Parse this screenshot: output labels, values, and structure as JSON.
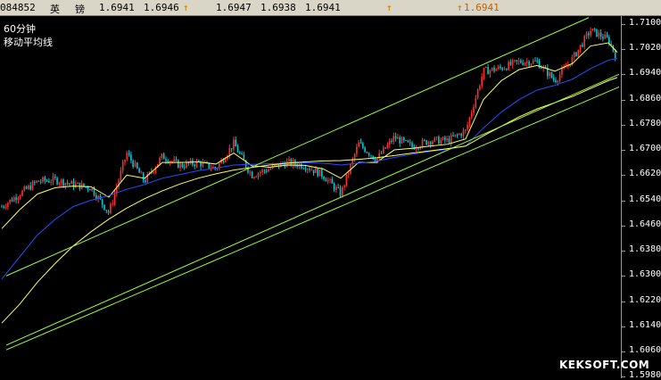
{
  "quote_bar": {
    "code": "084852",
    "name1": "英",
    "name2": "镑",
    "v1": "1.6941",
    "v2": "1.6946",
    "v3": "1.6947",
    "v4": "1.6938",
    "v5": "1.6941",
    "v6": "1.6941",
    "arrow_icon": "up-arrow-icon"
  },
  "titles": {
    "period": "60分钟",
    "indicator": "移动平均线"
  },
  "watermark": "KEKSOFT.COM",
  "colors": {
    "background": "#000000",
    "up_candle": "#ff3030",
    "down_candle": "#00c8d8",
    "ma_short": "#ffffff",
    "ma_mid": "#ffff60",
    "ma_long": "#2050ff",
    "trendline": "#9cff3c",
    "quote_bar_bg": "#d9d6c8"
  },
  "chart_data": {
    "type": "line",
    "title": "",
    "xlabel": "",
    "ylabel": "",
    "ylim": [
      1.5975,
      1.7125
    ],
    "ytick_labels": [
      "1.7100",
      "1.7020",
      "1.6940",
      "1.6860",
      "1.6780",
      "1.6700",
      "1.6620",
      "1.6540",
      "1.6460",
      "1.6380",
      "1.6300",
      "1.6220",
      "1.6140",
      "1.6060",
      "1.5980"
    ],
    "grid": false,
    "legend": "none",
    "x": [
      0,
      20,
      40,
      60,
      80,
      100,
      120,
      140,
      160,
      180,
      200,
      220,
      240,
      260,
      280,
      300,
      320,
      340,
      360,
      380,
      400,
      420,
      440,
      460,
      480,
      500,
      520,
      540,
      560,
      580,
      600,
      620,
      640,
      660,
      680,
      690
    ],
    "series": [
      {
        "values": [
          1.652,
          1.656,
          1.66,
          1.6605,
          1.659,
          1.658,
          1.65,
          1.669,
          1.66,
          1.668,
          1.665,
          1.666,
          1.664,
          1.672,
          1.662,
          1.664,
          1.666,
          1.665,
          1.662,
          1.656,
          1.672,
          1.667,
          1.674,
          1.671,
          1.673,
          1.673,
          1.676,
          1.695,
          1.696,
          1.698,
          1.698,
          1.692,
          1.699,
          1.708,
          1.705,
          1.699
        ]
      },
      {
        "values": [
          1.645,
          1.651,
          1.656,
          1.658,
          1.6585,
          1.6583,
          1.655,
          1.662,
          1.661,
          1.666,
          1.666,
          1.6662,
          1.6655,
          1.669,
          1.665,
          1.6645,
          1.6652,
          1.6651,
          1.664,
          1.661,
          1.666,
          1.666,
          1.67,
          1.6705,
          1.6712,
          1.6718,
          1.6735,
          1.686,
          1.692,
          1.6955,
          1.6968,
          1.695,
          1.6975,
          1.703,
          1.704,
          1.701
        ]
      },
      {
        "values": [
          1.629,
          1.636,
          1.643,
          1.648,
          1.652,
          1.654,
          1.6555,
          1.6575,
          1.659,
          1.661,
          1.6622,
          1.6634,
          1.6642,
          1.6652,
          1.6654,
          1.6656,
          1.6658,
          1.6659,
          1.6658,
          1.6652,
          1.6658,
          1.6664,
          1.6676,
          1.6686,
          1.6695,
          1.6702,
          1.6712,
          1.677,
          1.682,
          1.686,
          1.689,
          1.6905,
          1.6925,
          1.6958,
          1.6985,
          1.699
        ]
      },
      {
        "values": [
          1.615,
          1.621,
          1.628,
          1.634,
          1.6395,
          1.644,
          1.648,
          1.6515,
          1.6545,
          1.657,
          1.6592,
          1.661,
          1.6624,
          1.6636,
          1.6644,
          1.6652,
          1.6658,
          1.6662,
          1.6665,
          1.6666,
          1.667,
          1.6675,
          1.6682,
          1.669,
          1.6697,
          1.6704,
          1.6712,
          1.6745,
          1.6775,
          1.6805,
          1.683,
          1.685,
          1.687,
          1.6895,
          1.692,
          1.693
        ]
      }
    ],
    "candles": {
      "count": 300
    },
    "trendlines": [
      {
        "x": [
          5,
          658
        ],
        "values": [
          1.63,
          1.712
        ]
      },
      {
        "x": [
          5,
          692
        ],
        "values": [
          1.608,
          1.694
        ]
      },
      {
        "x": [
          5,
          692
        ],
        "values": [
          1.6065,
          1.69
        ]
      }
    ]
  }
}
